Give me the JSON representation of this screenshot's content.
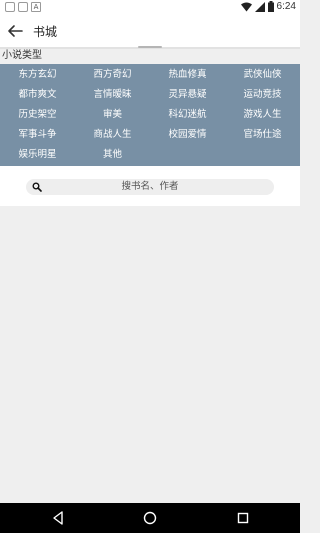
{
  "status": {
    "time": "6:24",
    "notification_a": "A"
  },
  "app_bar": {
    "title": "书城"
  },
  "category": {
    "label": "小说类型",
    "items": [
      "东方玄幻",
      "西方奇幻",
      "热血修真",
      "武侠仙侠",
      "都市爽文",
      "言情暧昧",
      "灵异悬疑",
      "运动竞技",
      "历史架空",
      "审美",
      "科幻迷航",
      "游戏人生",
      "军事斗争",
      "商战人生",
      "校园爱情",
      "官场仕途",
      "娱乐明星",
      "其他"
    ]
  },
  "search": {
    "placeholder": "搜书名、作者"
  },
  "colors": {
    "grid_bg": "#7890a5",
    "app_bar_bg": "#ffffff",
    "content_bg": "#efefef"
  },
  "icons": {
    "back": "arrow-left-icon",
    "search": "magnifier-icon",
    "wifi": "wifi-icon",
    "signal": "signal-icon",
    "battery": "battery-icon",
    "nav_back": "triangle-back-icon",
    "nav_home": "circle-home-icon",
    "nav_recent": "square-recent-icon"
  }
}
